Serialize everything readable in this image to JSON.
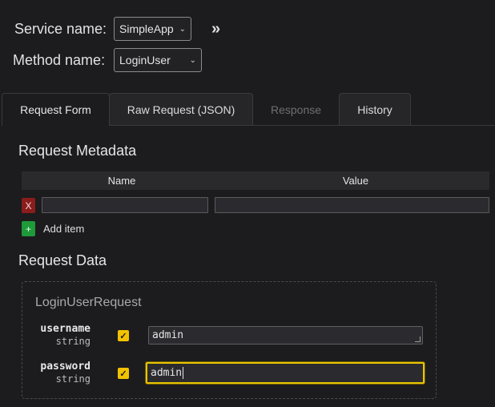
{
  "service": {
    "label": "Service name:",
    "value": "SimpleApp",
    "expand_label": "»"
  },
  "method": {
    "label": "Method name:",
    "value": "LoginUser"
  },
  "tabs": [
    {
      "label": "Request Form",
      "state": "active"
    },
    {
      "label": "Raw Request (JSON)",
      "state": "normal"
    },
    {
      "label": "Response",
      "state": "disabled"
    },
    {
      "label": "History",
      "state": "normal"
    }
  ],
  "metadata": {
    "title": "Request Metadata",
    "columns": [
      "Name",
      "Value"
    ],
    "rows": [
      {
        "name": "",
        "value": ""
      }
    ],
    "remove_label": "X",
    "add_icon": "+",
    "add_label": "Add item"
  },
  "request_data": {
    "title": "Request Data",
    "message_name": "LoginUserRequest",
    "fields": [
      {
        "name": "username",
        "type": "string",
        "checked": true,
        "value": "admin"
      },
      {
        "name": "password",
        "type": "string",
        "checked": true,
        "value": "admin"
      }
    ]
  },
  "colors": {
    "background": "#1c1c1e",
    "accent": "#f2c200",
    "remove": "#8b1c1c",
    "add": "#1e9a3a"
  }
}
